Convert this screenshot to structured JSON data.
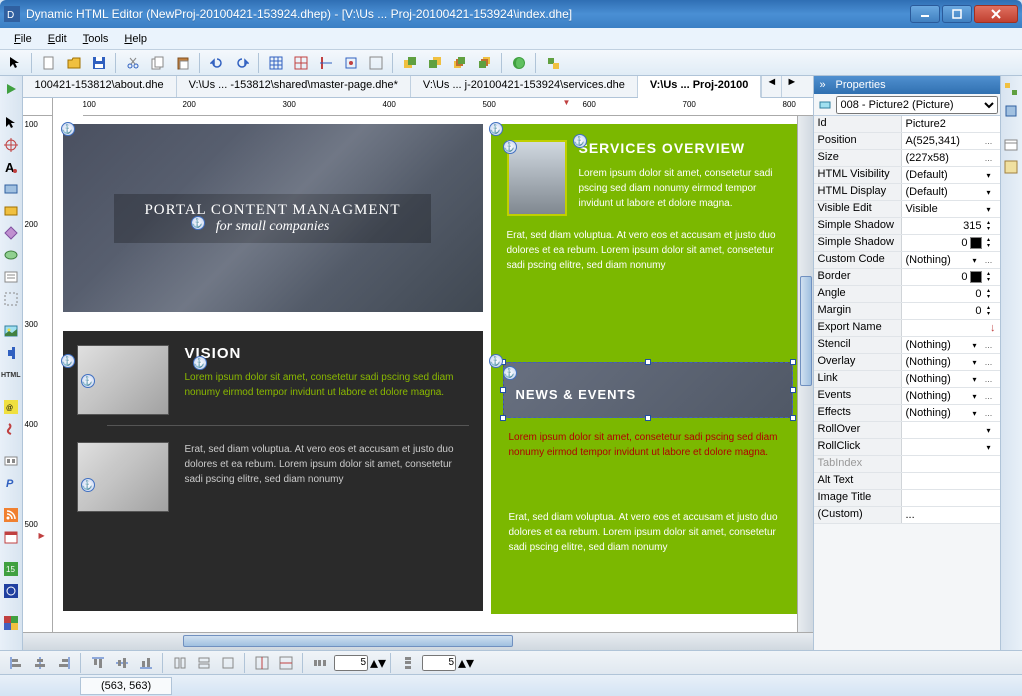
{
  "window": {
    "title": "Dynamic HTML Editor (NewProj-20100421-153924.dhep) - [V:\\Us ... Proj-20100421-153924\\index.dhe]"
  },
  "menu": {
    "file": "File",
    "edit": "Edit",
    "tools": "Tools",
    "help": "Help"
  },
  "tabs": [
    {
      "label": "100421-153812\\about.dhe"
    },
    {
      "label": "V:\\Us ... -153812\\shared\\master-page.dhe*"
    },
    {
      "label": "V:\\Us ... j-20100421-153924\\services.dhe"
    },
    {
      "label": "V:\\Us ... Proj-20100",
      "active": true
    }
  ],
  "ruler": {
    "h": [
      "100",
      "200",
      "300",
      "400",
      "500",
      "600",
      "700",
      "800"
    ],
    "v": [
      "100",
      "200",
      "300",
      "400",
      "500"
    ]
  },
  "hero": {
    "title": "PORTAL CONTENT MANAGMENT",
    "subtitle": "for small companies"
  },
  "vision": {
    "title": "VISION",
    "p1": "Lorem ipsum dolor sit amet, consetetur sadi pscing sed diam nonumy eirmod tempor invidunt ut labore et dolore magna.",
    "p2": "Erat, sed diam voluptua. At vero eos et accusam et justo duo dolores et ea rebum. Lorem ipsum dolor sit amet, consetetur sadi pscing elitre, sed diam nonumy"
  },
  "services": {
    "title": "SERVICES OVERVIEW",
    "p1": "Lorem ipsum dolor sit amet, consetetur sadi pscing sed diam nonumy eirmod tempor invidunt ut labore et dolore magna.",
    "p2": "Erat, sed diam voluptua. At vero eos et accusam et justo duo dolores et ea rebum. Lorem ipsum dolor sit amet, consetetur sadi pscing elitre, sed diam nonumy"
  },
  "news": {
    "title": "NEWS & EVENTS",
    "red": "Lorem ipsum dolor sit amet, consetetur sadi pscing sed diam nonumy eirmod tempor invidunt ut labore et dolore magna.",
    "after": "Erat, sed diam voluptua. At vero eos et accusam et justo duo dolores et ea rebum. Lorem ipsum dolor sit amet, consetetur sadi pscing elitre, sed diam nonumy"
  },
  "properties": {
    "header": "Properties",
    "selector": "008 - Picture2 (Picture)",
    "rows": [
      {
        "name": "Id",
        "val": "Picture2"
      },
      {
        "name": "Position",
        "val": "A(525,341)",
        "more": true
      },
      {
        "name": "Size",
        "val": "(227x58)",
        "more": true
      },
      {
        "name": "HTML Visibility",
        "val": "(Default)",
        "dd": true
      },
      {
        "name": "HTML Display",
        "val": "(Default)",
        "dd": true
      },
      {
        "name": "Visible Edit",
        "val": "Visible",
        "dd": true
      },
      {
        "name": "Simple Shadow",
        "val": "315",
        "spin": true
      },
      {
        "name": "Simple Shadow",
        "val": "0",
        "spin": true,
        "swatch": "#000"
      },
      {
        "name": "Custom Code",
        "val": "(Nothing)",
        "dd": true,
        "more": true
      },
      {
        "name": "Border",
        "val": "0",
        "spin": true,
        "swatch": "#000"
      },
      {
        "name": "Angle",
        "val": "0",
        "spin": true
      },
      {
        "name": "Margin",
        "val": "0",
        "spin": true
      },
      {
        "name": "Export Name",
        "val": "",
        "warn": true
      },
      {
        "name": "Stencil",
        "val": "(Nothing)",
        "dd": true,
        "more": true
      },
      {
        "name": "Overlay",
        "val": "(Nothing)",
        "dd": true,
        "more": true
      },
      {
        "name": "Link",
        "val": "(Nothing)",
        "dd": true,
        "more": true
      },
      {
        "name": "Events",
        "val": "(Nothing)",
        "dd": true,
        "more": true
      },
      {
        "name": "Effects",
        "val": "(Nothing)",
        "dd": true,
        "more": true
      },
      {
        "name": "RollOver",
        "val": "",
        "dd": true
      },
      {
        "name": "RollClick",
        "val": "",
        "dd": true
      },
      {
        "name": "TabIndex",
        "val": "",
        "disabled": true
      },
      {
        "name": "Alt Text",
        "val": ""
      },
      {
        "name": "Image Title",
        "val": ""
      },
      {
        "name": "(Custom)",
        "val": "...",
        "more": false
      }
    ]
  },
  "align": {
    "v1": "5",
    "v2": "5"
  },
  "status": {
    "coords": "(563, 563)"
  }
}
